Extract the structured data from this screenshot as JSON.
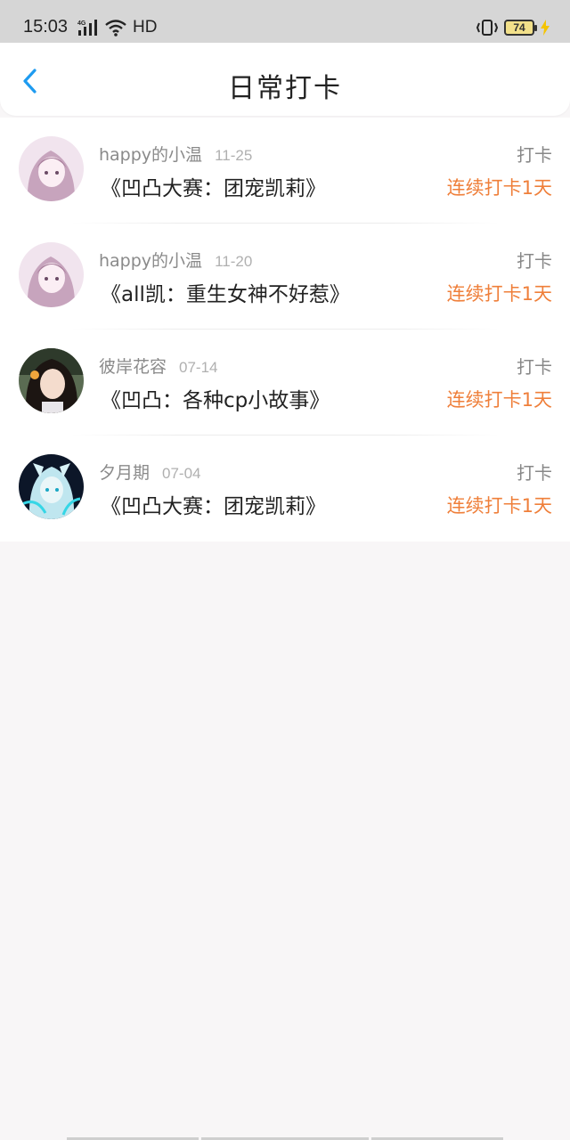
{
  "status_bar": {
    "time": "15:03",
    "network": "HD",
    "battery": "74",
    "icons": [
      "4g-signal-icon",
      "wifi-icon",
      "vibrate-icon",
      "battery-icon",
      "charging-icon"
    ]
  },
  "header": {
    "title": "日常打卡",
    "back_icon": "back-chevron-icon"
  },
  "colors": {
    "accent": "#1e9bf0",
    "streak": "#ef7f3a",
    "background": "#f8f6f7"
  },
  "list": [
    {
      "user": "happy的小温",
      "date": "11-25",
      "title": "《凹凸大赛：团宠凯莉》",
      "action": "打卡",
      "streak": "连续打卡1天"
    },
    {
      "user": "happy的小温",
      "date": "11-20",
      "title": "《all凯：重生女神不好惹》",
      "action": "打卡",
      "streak": "连续打卡1天"
    },
    {
      "user": "彼岸花容",
      "date": "07-14",
      "title": "《凹凸：各种cp小故事》",
      "action": "打卡",
      "streak": "连续打卡1天"
    },
    {
      "user": "夕月期",
      "date": "07-04",
      "title": "《凹凸大赛：团宠凯莉》",
      "action": "打卡",
      "streak": "连续打卡1天"
    }
  ]
}
